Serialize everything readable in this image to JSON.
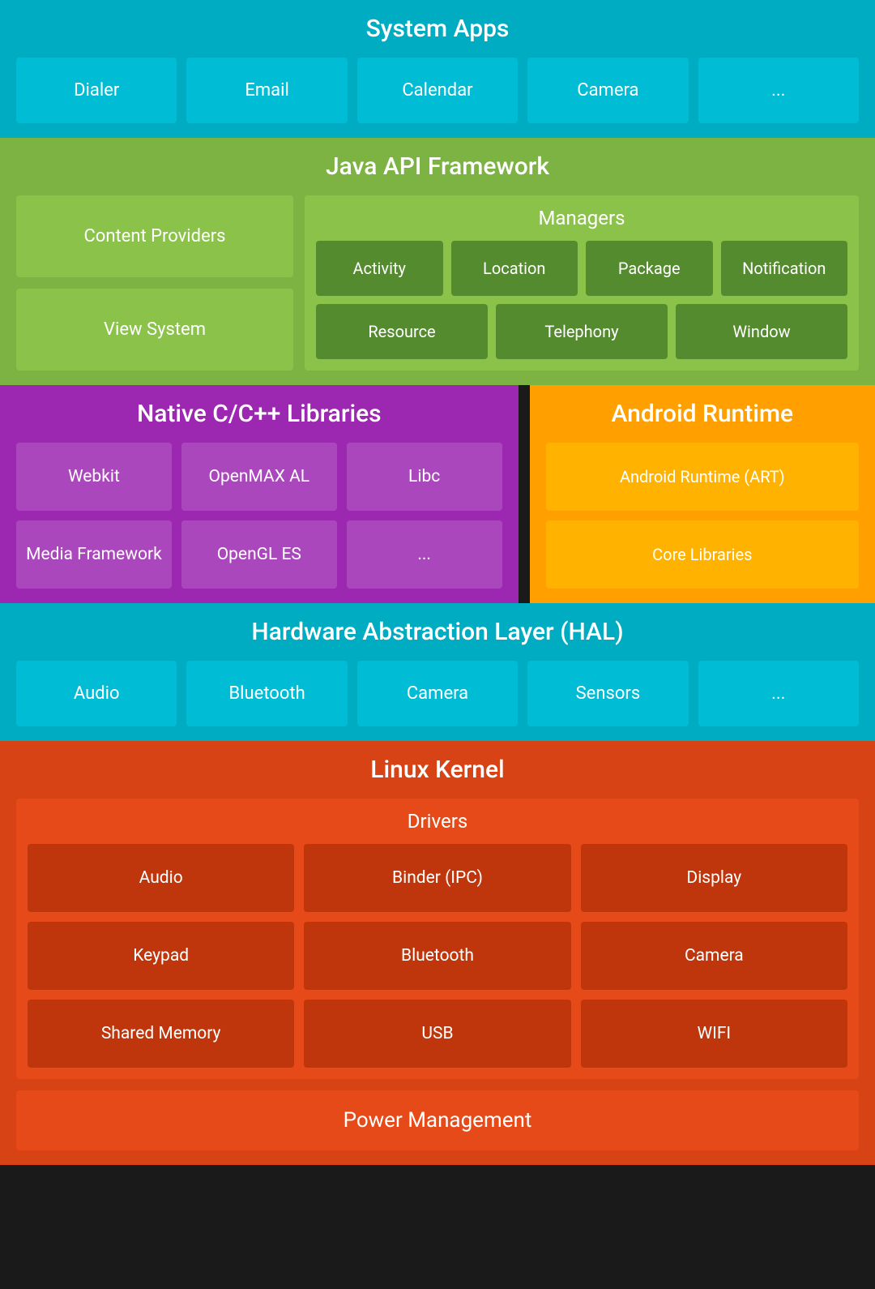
{
  "system_apps": {
    "title": "System Apps",
    "apps": [
      "Dialer",
      "Email",
      "Calendar",
      "Camera",
      "..."
    ]
  },
  "java_api": {
    "title": "Java API Framework",
    "left_items": [
      "Content Providers",
      "View System"
    ],
    "managers": {
      "title": "Managers",
      "row1": [
        "Activity",
        "Location",
        "Package",
        "Notification"
      ],
      "row2": [
        "Resource",
        "Telephony",
        "Window"
      ]
    }
  },
  "native_cpp": {
    "title": "Native C/C++ Libraries",
    "items": [
      "Webkit",
      "OpenMAX AL",
      "Libc",
      "Media Framework",
      "OpenGL ES",
      "..."
    ]
  },
  "android_runtime": {
    "title": "Android Runtime",
    "items": [
      "Android Runtime (ART)",
      "Core Libraries"
    ]
  },
  "hal": {
    "title": "Hardware Abstraction Layer (HAL)",
    "items": [
      "Audio",
      "Bluetooth",
      "Camera",
      "Sensors",
      "..."
    ]
  },
  "linux_kernel": {
    "title": "Linux Kernel",
    "drivers_title": "Drivers",
    "drivers": [
      "Audio",
      "Binder (IPC)",
      "Display",
      "Keypad",
      "Bluetooth",
      "Camera",
      "Shared Memory",
      "USB",
      "WIFI"
    ],
    "power_management": "Power Management"
  }
}
